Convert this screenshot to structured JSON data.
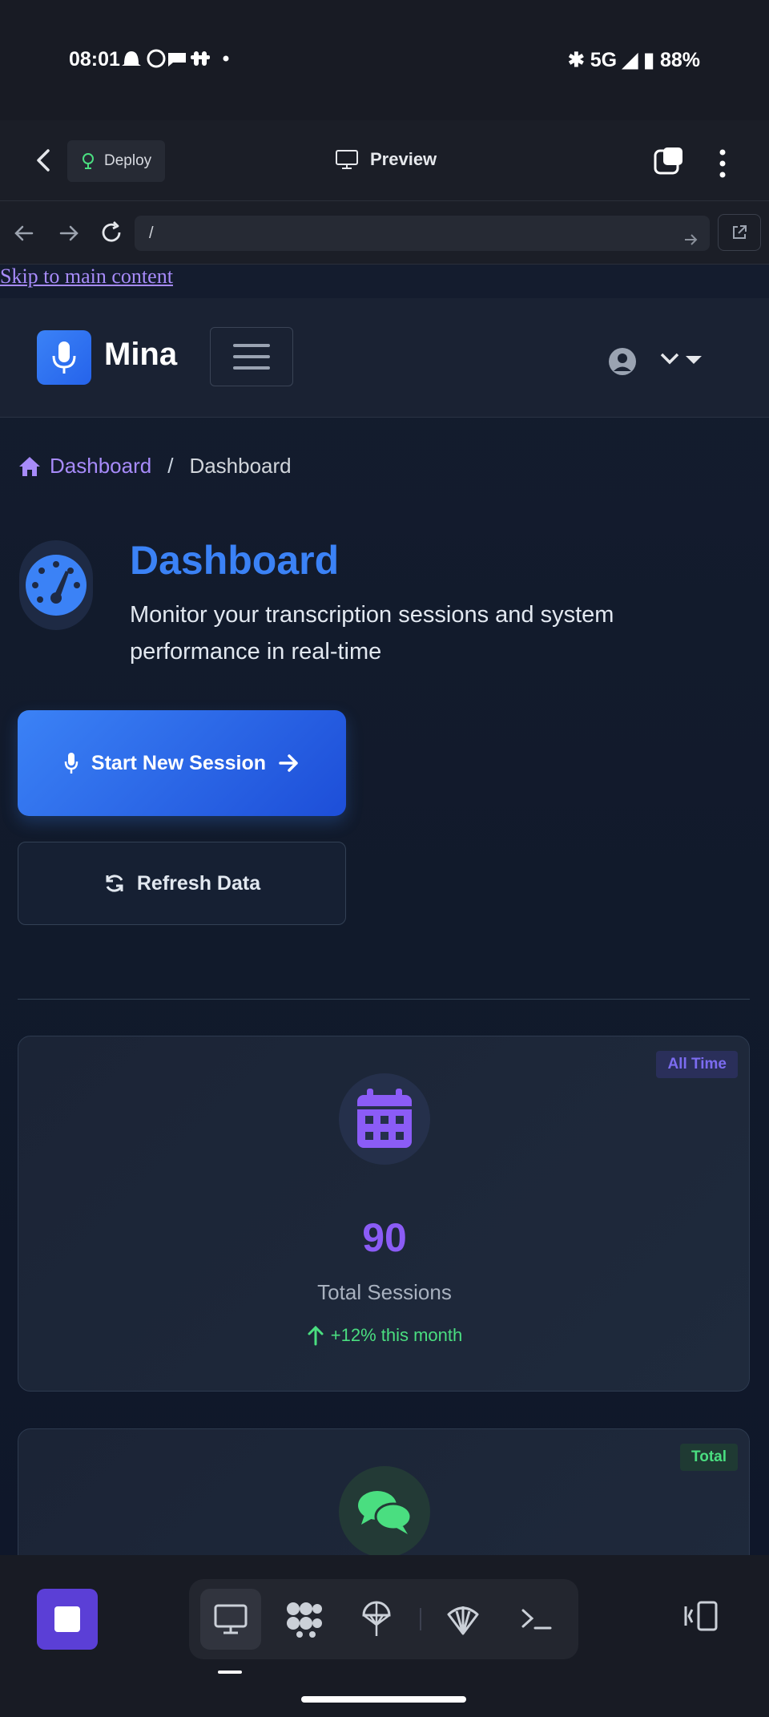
{
  "status_bar": {
    "time": "08:01",
    "notification_icons": [
      "snapchat-icon",
      "whatsapp-icon",
      "chat-bubble-icon",
      "slack-icon",
      "dot-icon"
    ],
    "network": "5G",
    "battery": "88%"
  },
  "toolbar": {
    "deploy_label": "Deploy",
    "preview_label": "Preview"
  },
  "urlbar": {
    "url": "/"
  },
  "page": {
    "skip_link": "Skip to main content",
    "brand": "Mina",
    "breadcrumb": {
      "home": "Dashboard",
      "separator": "/",
      "current": "Dashboard"
    },
    "title": "Dashboard",
    "subtitle": "Monitor your transcription sessions and system performance in real-time",
    "start_button": "Start New Session",
    "refresh_button": "Refresh Data",
    "cards": [
      {
        "badge": "All Time",
        "value": "90",
        "label": "Total Sessions",
        "trend": "+12% this month"
      },
      {
        "badge": "Total"
      }
    ]
  },
  "colors": {
    "accent_blue": "#3b82f6",
    "accent_purple": "#8b5cf6",
    "link_purple": "#a78bfa",
    "success_green": "#4ade80",
    "background": "#0f172a"
  }
}
